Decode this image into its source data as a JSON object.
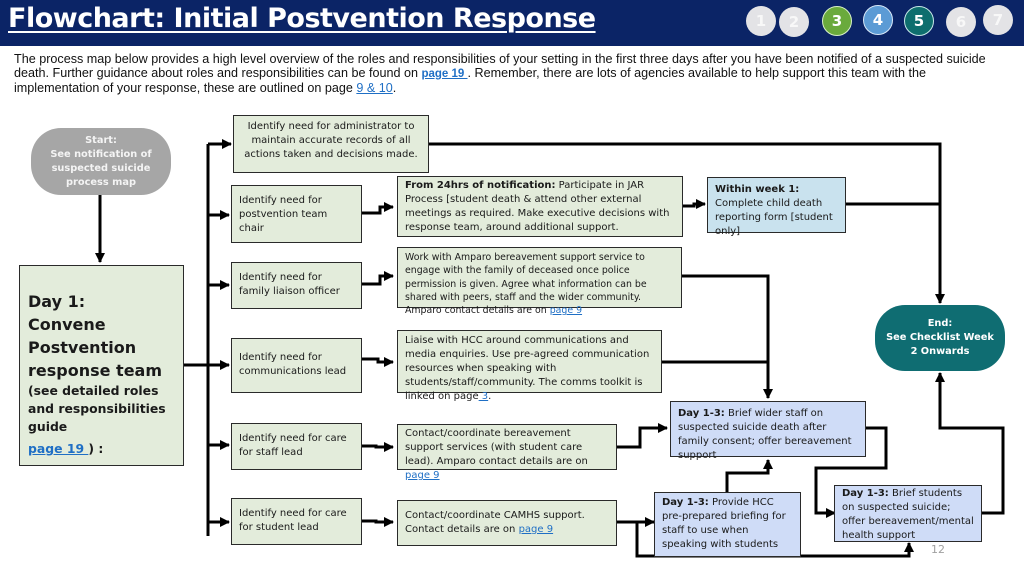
{
  "header": {
    "title": "Flowchart: Initial Postvention Response",
    "nav": [
      {
        "label": "1",
        "state": "inactive",
        "color": "#e3e3e6"
      },
      {
        "label": "2",
        "state": "inactive",
        "color": "#e3e3e6"
      },
      {
        "label": "3",
        "state": "active",
        "color": "#6aaa3c"
      },
      {
        "label": "4",
        "state": "active",
        "color": "#5b9bd5"
      },
      {
        "label": "5",
        "state": "active",
        "color": "#0e6e6e"
      },
      {
        "label": "6",
        "state": "inactive",
        "color": "#e3e3e6"
      },
      {
        "label": "7",
        "state": "inactive",
        "color": "#e3e3e6"
      }
    ]
  },
  "intro": {
    "part1": "The process map below provides a high level overview of the roles and responsibilities of your setting in the first three days after you have been notified of a suspected suicide death. Further guidance about roles and responsibilities can be found on ",
    "link1": "page 19 ",
    "part2": ". Remember, there are lots of agencies available to help support this team with the implementation of your response, these are outlined on page ",
    "link2": "9 & 10",
    "part3": "."
  },
  "start": {
    "label": "Start:",
    "text": "See notification of suspected suicide process map"
  },
  "day1": {
    "line1": "Day 1:",
    "line2": "Convene",
    "line3": "Postvention",
    "line4": "response team",
    "sub": "(see detailed roles and responsibilities guide",
    "link": "page 19 ",
    "suffix": ") :"
  },
  "roles": [
    {
      "text": "Identify need for administrator to maintain accurate records of all actions taken and decisions made."
    },
    {
      "text": "Identify need for postvention team chair"
    },
    {
      "text": "Identify need for family liaison officer"
    },
    {
      "text": "Identify need for communications lead"
    },
    {
      "text": "Identify need for care for staff lead"
    },
    {
      "text": "Identify need for care for student lead"
    }
  ],
  "actions": {
    "chair": {
      "bold": "From 24hrs of notification:",
      "text": " Participate in JAR Process [student death & attend other external meetings as required. Make executive decisions with response team, around additional support."
    },
    "family": {
      "text": "Work with Amparo bereavement support service to engage with the family of deceased once police permission is given. Agree what information can be shared with peers, staff and the wider community. Amparo contact details are on ",
      "link": "page 9"
    },
    "comms": {
      "text": "Liaise with HCC around communications and media enquiries. Use pre-agreed communication resources when speaking with students/staff/community. The comms toolkit is linked on page",
      "link": " 3",
      "suffix": "."
    },
    "staff": {
      "text": "Contact/coordinate bereavement support services (with student care lead). Amparo contact details are on ",
      "link": "page 9"
    },
    "student": {
      "text": "Contact/coordinate CAMHS support. Contact details are on ",
      "link": "page 9"
    },
    "week1": {
      "bold": "Within week 1:",
      "text": " Complete child death reporting form [student only]"
    },
    "brief_staff": {
      "bold": "Day 1-3:",
      "text": " Brief wider staff on suspected suicide death after family consent; offer bereavement support"
    },
    "hcc_brief": {
      "bold": "Day 1-3:",
      "text": " Provide HCC pre-prepared briefing for staff to use when speaking with students"
    },
    "brief_students": {
      "bold": "Day 1-3:",
      "text": " Brief students on suspected suicide; offer bereavement/mental health support"
    }
  },
  "end": {
    "label": "End:",
    "text": "See Checklist Week 2 Onwards"
  },
  "page_number": "12"
}
